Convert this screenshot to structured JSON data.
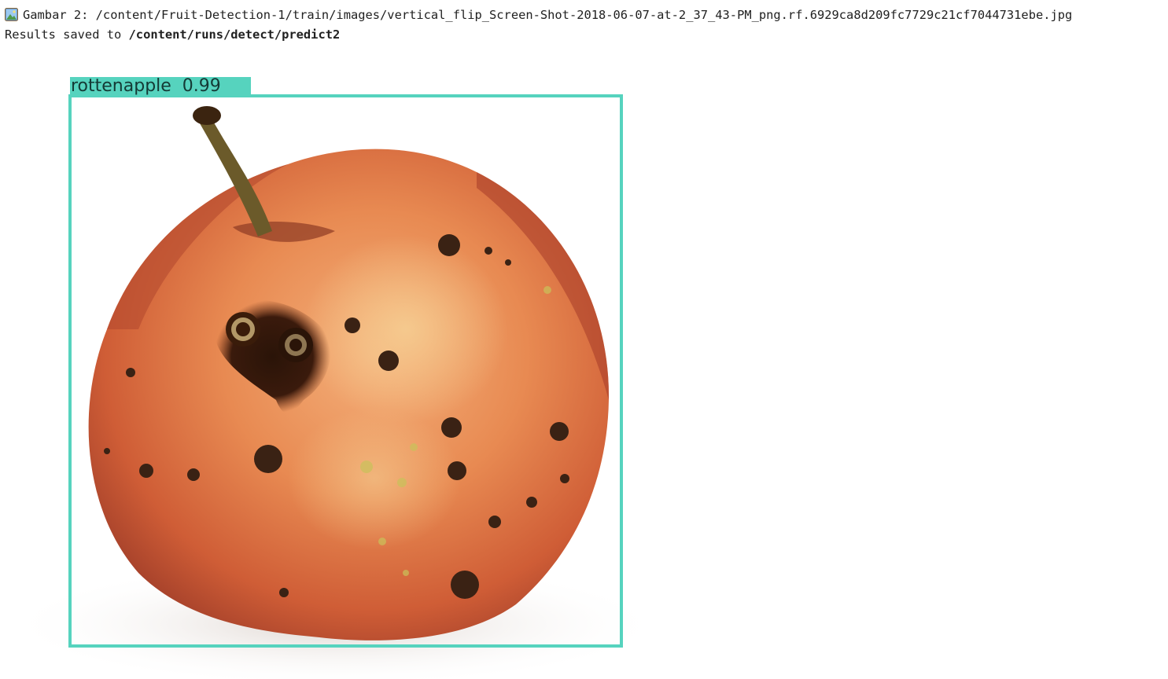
{
  "output": {
    "line1": {
      "icon": "framed-picture-icon",
      "text": "Gambar 2: /content/Fruit-Detection-1/train/images/vertical_flip_Screen-Shot-2018-06-07-at-2_37_43-PM_png.rf.6929ca8d209fc7729c21cf7044731ebe.jpg"
    },
    "line2": {
      "prefix": "Results saved to ",
      "path": "/content/runs/detect/predict2"
    }
  },
  "detection": {
    "label": "rottenapple",
    "confidence": "0.99",
    "label_text": "rottenapple  0.99",
    "box_color": "#56d3be"
  }
}
